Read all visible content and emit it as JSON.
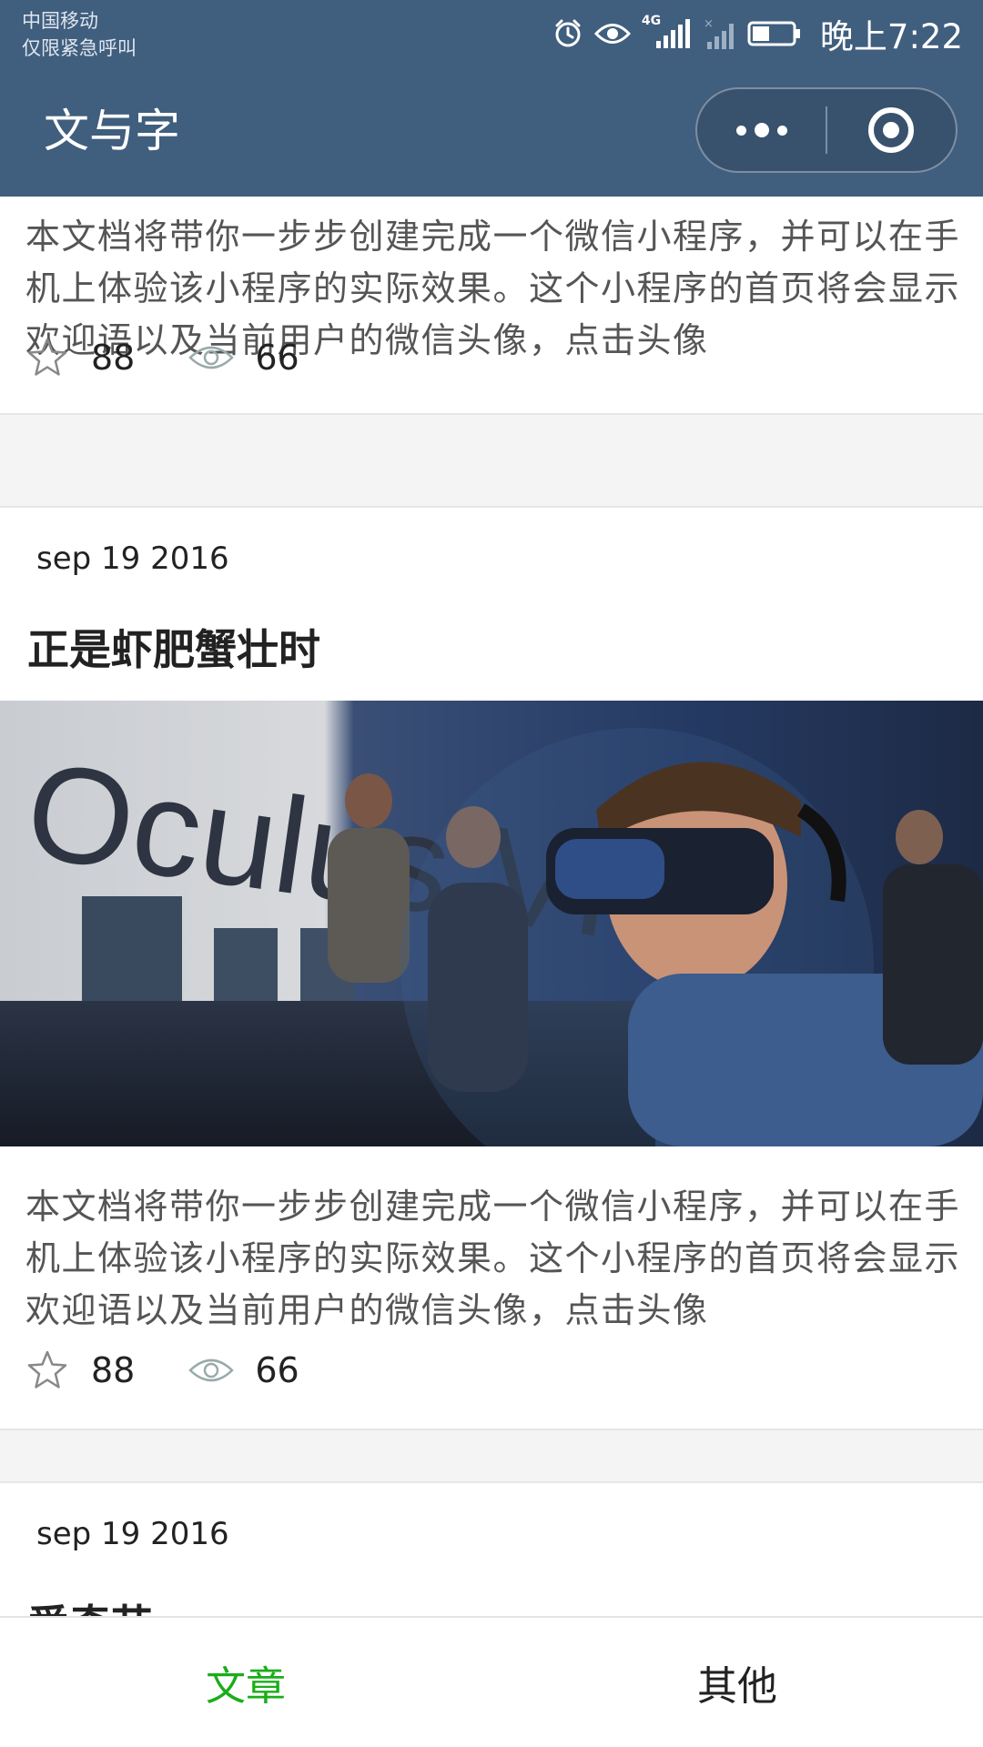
{
  "status_bar": {
    "carrier_line1": "中国移动",
    "carrier_line2": "仅限紧急呼叫",
    "network": "4G",
    "time": "晚上7:22"
  },
  "nav": {
    "title": "文与字"
  },
  "articles": [
    {
      "excerpt": "本文档将带你一步步创建完成一个微信小程序，并可以在手机上体验该小程序的实际效果。这个小程序的首页将会显示欢迎语以及当前用户的微信头像，点击头像",
      "stars": "88",
      "views": "66"
    },
    {
      "date": "sep 19 2016",
      "title": "正是虾肥蟹壮时",
      "image_text": "Oculus VR",
      "excerpt": "本文档将带你一步步创建完成一个微信小程序，并可以在手机上体验该小程序的实际效果。这个小程序的首页将会显示欢迎语以及当前用户的微信头像，点击头像",
      "stars": "88",
      "views": "66"
    },
    {
      "date": "sep 19 2016",
      "title": "爱奇艺"
    }
  ],
  "tabs": [
    {
      "label": "文章",
      "active": true
    },
    {
      "label": "其他",
      "active": false
    }
  ],
  "colors": {
    "header": "#405e7e",
    "tab_active": "#1aad19",
    "tab_inactive": "#222222"
  }
}
